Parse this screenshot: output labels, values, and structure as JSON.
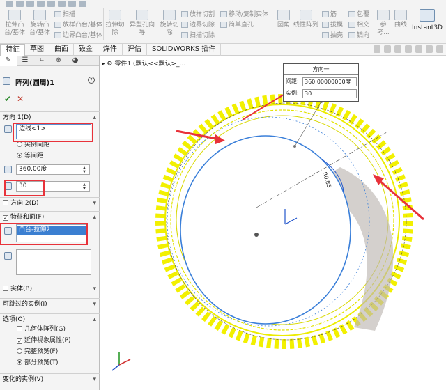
{
  "ribbon": {
    "groups": [
      {
        "label": "拉伸凸台/基体"
      },
      {
        "label": "旋转凸台/基体"
      },
      {
        "label": "扫描"
      },
      {
        "label": "放样凸台/基体"
      },
      {
        "label": "边界凸台/基体"
      },
      {
        "label": "拉伸切除"
      },
      {
        "label": "异型孔向导"
      },
      {
        "label": "旋转切除"
      },
      {
        "label": "放样切割"
      },
      {
        "label": "边界切除"
      },
      {
        "label": "扫描切除"
      },
      {
        "label": "移动/复制实体"
      },
      {
        "label": "简单直孔"
      },
      {
        "label": "圆角"
      },
      {
        "label": "线性阵列"
      },
      {
        "label": "筋"
      },
      {
        "label": "拔模"
      },
      {
        "label": "抽壳"
      },
      {
        "label": "包覆"
      },
      {
        "label": "相交"
      },
      {
        "label": "镜向"
      },
      {
        "label": "参考..."
      },
      {
        "label": "曲线"
      },
      {
        "label": "Instant3D"
      }
    ]
  },
  "tabs": [
    {
      "label": "特征",
      "active": true
    },
    {
      "label": "草图"
    },
    {
      "label": "曲面"
    },
    {
      "label": "钣金"
    },
    {
      "label": "焊件"
    },
    {
      "label": "评估"
    },
    {
      "label": "SOLIDWORKS 插件"
    }
  ],
  "panel": {
    "title": "阵列(圆周)1",
    "help": "?",
    "ok": "✔",
    "cancel": "✕",
    "direction1": {
      "header": "方向 1(D)",
      "edge_value": "边线<1>",
      "radio_spacing": "实例间距",
      "radio_equal": "等间距",
      "angle_value": "360.00度",
      "count_value": "30"
    },
    "direction2": {
      "header": "方向 2(D)"
    },
    "features": {
      "header": "特征和面(F)",
      "item": "凸台-拉伸2"
    },
    "bodies": {
      "header": "实体(B)"
    },
    "skip": {
      "header": "可跳过的实例(I)"
    },
    "options": {
      "header": "选项(O)",
      "geometry_pattern": "几何体阵列(G)",
      "propagate_visual": "延伸视象属性(P)",
      "full_preview": "完整预览(F)",
      "partial_preview": "部分预览(T)"
    },
    "vary": {
      "header": "变化的实例(V)"
    }
  },
  "graphics": {
    "tree_path": "零件1  (默认<<默认>_...",
    "callout": {
      "title": "方向一",
      "spacing_label": "间距:",
      "spacing_value": "360.00000000度",
      "count_label": "实例:",
      "count_value": "30"
    },
    "dim_label": "R0.85",
    "colors": {
      "preview_yellow": "#f2f000",
      "edge_blue": "#3a7fd9",
      "annotation_red": "#e8323a"
    }
  }
}
